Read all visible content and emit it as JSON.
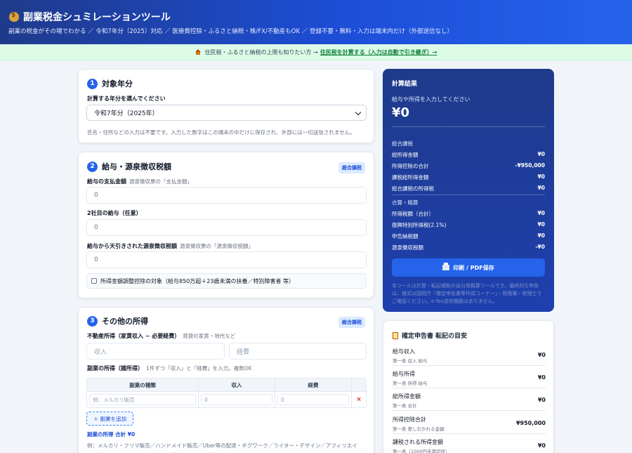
{
  "header": {
    "title": "副業税金シュミレーションツール",
    "subtitle": "副業の税金がその場でわかる ／ 令和7年分（2025）対応 ／ 医療費控除・ふるさと納税・株/FX/不動産もOK ／ 登録不要・無料・入力は端末内だけ（外部送信なし）"
  },
  "banner": {
    "text": "住民税・ふるさと納税の上限も知りたい方 →",
    "link": "住民税を計算する（入力は自動で引き継ぎ）→"
  },
  "section1": {
    "num": "1",
    "title": "対象年分",
    "label": "計算する年分を選んでください",
    "select_value": "令和7年分（2025年）",
    "note": "氏名・住所などの入力は不要です。入力した数字はこの端末の中だけに保存され、外部には一切送信されません。"
  },
  "section2": {
    "num": "2",
    "title": "給与・源泉徴収税額",
    "badge": "総合課税",
    "salary_label": "給与の支払金額",
    "salary_hint": "源泉徴収票の「支払金額」",
    "salary_value": "0",
    "second_label": "2社目の給与（任意）",
    "second_value": "0",
    "withholding_label": "給与から天引きされた源泉徴収税額",
    "withholding_hint": "源泉徴収票の「源泉徴収税額」",
    "withholding_value": "0",
    "checkbox_label": "所得金額調整控除の対象（給与850万超＋23歳未満の扶養／特別障害者 等）"
  },
  "section3": {
    "num": "3",
    "title": "その他の所得",
    "badge": "総合課税",
    "realestate_label": "不動産所得（家賃収入 − 必要経費）",
    "realestate_hint": "賃貸の家賃・地代など",
    "income_placeholder": "収入",
    "expense_placeholder": "経費",
    "side_label": "副業の所得（雑所得）",
    "side_hint": "1件ずつ「収入」と「経費」を入力。複数OK",
    "table_headers": [
      "副業の種類",
      "収入",
      "経費"
    ],
    "row_placeholder": "例：メルカリ販売",
    "row_income": "0",
    "row_expense": "0",
    "delete_symbol": "×",
    "add_button": "＋ 副業を追加",
    "sum_text": "副業の所得 合計 ¥0",
    "examples": "例：メルカリ・フリマ販売／ハンドメイド販売／Uber等の配達・ギグワーク／ライター・デザイン／アフィリエイト・ブログ・YouTube・配信の投げ銭／セミナー・講師・コンサル など"
  },
  "result": {
    "title": "計算結果",
    "prompt": "給与や所得を入力してください",
    "amount": "¥0",
    "group1": "総合課税",
    "rows1": [
      {
        "label": "総所得金額",
        "value": "¥0"
      },
      {
        "label": "所得控除の合計",
        "value": "-¥950,000"
      },
      {
        "label": "課税総所得金額",
        "value": "¥0"
      },
      {
        "label": "総合課税の所得税",
        "value": "¥0"
      }
    ],
    "group2": "合算・精算",
    "rows2": [
      {
        "label": "所得税額（合計）",
        "value": "¥0"
      },
      {
        "label": "復興特別所得税(2.1%)",
        "value": "¥0"
      },
      {
        "label": "申告納税額",
        "value": "¥0"
      },
      {
        "label": "源泉徴収税額",
        "value": "-¥0"
      }
    ],
    "print_button": "印刷 / PDF保存",
    "disclaimer": "本ツールは計算・転記補助の自分用概算ツールです。最終的な申告は、様式は国税庁「確定申告書等作成コーナー」・税務署・税理士でご確認ください。e-Tax送信機能はありません。"
  },
  "summary": {
    "title": "確定申告書 転記の目安",
    "rows": [
      {
        "label": "給与収入",
        "sub": "第一表 収入 給与",
        "value": "¥0"
      },
      {
        "label": "給与所得",
        "sub": "第一表 所得 給与",
        "value": "¥0"
      },
      {
        "label": "総所得金額",
        "sub": "第一表 合計",
        "value": "¥0"
      },
      {
        "label": "所得控除合計",
        "sub": "第一表 差し引かれる金額",
        "value": "¥950,000"
      },
      {
        "label": "課税される所得金額",
        "sub": "第一表（1000円未満切捨）",
        "value": "¥0"
      }
    ]
  }
}
